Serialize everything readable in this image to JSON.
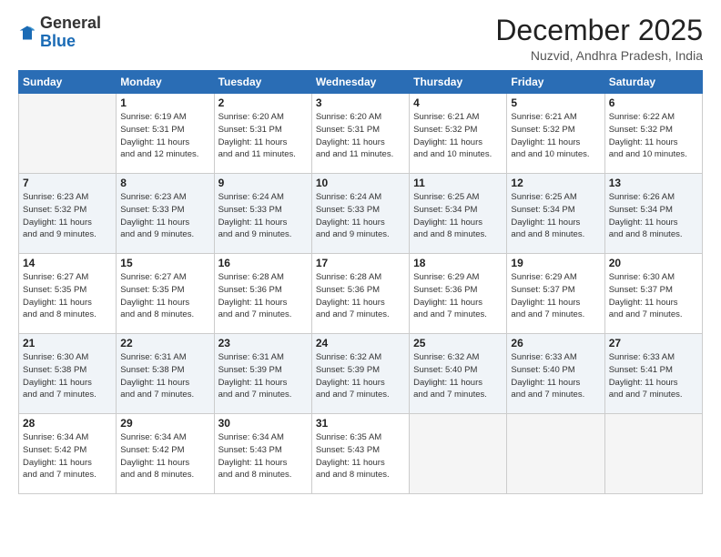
{
  "logo": {
    "general": "General",
    "blue": "Blue"
  },
  "header": {
    "month": "December 2025",
    "location": "Nuzvid, Andhra Pradesh, India"
  },
  "weekdays": [
    "Sunday",
    "Monday",
    "Tuesday",
    "Wednesday",
    "Thursday",
    "Friday",
    "Saturday"
  ],
  "weeks": [
    [
      {
        "num": "",
        "sunrise": "",
        "sunset": "",
        "daylight": "",
        "empty": true
      },
      {
        "num": "1",
        "sunrise": "Sunrise: 6:19 AM",
        "sunset": "Sunset: 5:31 PM",
        "daylight": "Daylight: 11 hours and 12 minutes."
      },
      {
        "num": "2",
        "sunrise": "Sunrise: 6:20 AM",
        "sunset": "Sunset: 5:31 PM",
        "daylight": "Daylight: 11 hours and 11 minutes."
      },
      {
        "num": "3",
        "sunrise": "Sunrise: 6:20 AM",
        "sunset": "Sunset: 5:31 PM",
        "daylight": "Daylight: 11 hours and 11 minutes."
      },
      {
        "num": "4",
        "sunrise": "Sunrise: 6:21 AM",
        "sunset": "Sunset: 5:32 PM",
        "daylight": "Daylight: 11 hours and 10 minutes."
      },
      {
        "num": "5",
        "sunrise": "Sunrise: 6:21 AM",
        "sunset": "Sunset: 5:32 PM",
        "daylight": "Daylight: 11 hours and 10 minutes."
      },
      {
        "num": "6",
        "sunrise": "Sunrise: 6:22 AM",
        "sunset": "Sunset: 5:32 PM",
        "daylight": "Daylight: 11 hours and 10 minutes."
      }
    ],
    [
      {
        "num": "7",
        "sunrise": "Sunrise: 6:23 AM",
        "sunset": "Sunset: 5:32 PM",
        "daylight": "Daylight: 11 hours and 9 minutes."
      },
      {
        "num": "8",
        "sunrise": "Sunrise: 6:23 AM",
        "sunset": "Sunset: 5:33 PM",
        "daylight": "Daylight: 11 hours and 9 minutes."
      },
      {
        "num": "9",
        "sunrise": "Sunrise: 6:24 AM",
        "sunset": "Sunset: 5:33 PM",
        "daylight": "Daylight: 11 hours and 9 minutes."
      },
      {
        "num": "10",
        "sunrise": "Sunrise: 6:24 AM",
        "sunset": "Sunset: 5:33 PM",
        "daylight": "Daylight: 11 hours and 9 minutes."
      },
      {
        "num": "11",
        "sunrise": "Sunrise: 6:25 AM",
        "sunset": "Sunset: 5:34 PM",
        "daylight": "Daylight: 11 hours and 8 minutes."
      },
      {
        "num": "12",
        "sunrise": "Sunrise: 6:25 AM",
        "sunset": "Sunset: 5:34 PM",
        "daylight": "Daylight: 11 hours and 8 minutes."
      },
      {
        "num": "13",
        "sunrise": "Sunrise: 6:26 AM",
        "sunset": "Sunset: 5:34 PM",
        "daylight": "Daylight: 11 hours and 8 minutes."
      }
    ],
    [
      {
        "num": "14",
        "sunrise": "Sunrise: 6:27 AM",
        "sunset": "Sunset: 5:35 PM",
        "daylight": "Daylight: 11 hours and 8 minutes."
      },
      {
        "num": "15",
        "sunrise": "Sunrise: 6:27 AM",
        "sunset": "Sunset: 5:35 PM",
        "daylight": "Daylight: 11 hours and 8 minutes."
      },
      {
        "num": "16",
        "sunrise": "Sunrise: 6:28 AM",
        "sunset": "Sunset: 5:36 PM",
        "daylight": "Daylight: 11 hours and 7 minutes."
      },
      {
        "num": "17",
        "sunrise": "Sunrise: 6:28 AM",
        "sunset": "Sunset: 5:36 PM",
        "daylight": "Daylight: 11 hours and 7 minutes."
      },
      {
        "num": "18",
        "sunrise": "Sunrise: 6:29 AM",
        "sunset": "Sunset: 5:36 PM",
        "daylight": "Daylight: 11 hours and 7 minutes."
      },
      {
        "num": "19",
        "sunrise": "Sunrise: 6:29 AM",
        "sunset": "Sunset: 5:37 PM",
        "daylight": "Daylight: 11 hours and 7 minutes."
      },
      {
        "num": "20",
        "sunrise": "Sunrise: 6:30 AM",
        "sunset": "Sunset: 5:37 PM",
        "daylight": "Daylight: 11 hours and 7 minutes."
      }
    ],
    [
      {
        "num": "21",
        "sunrise": "Sunrise: 6:30 AM",
        "sunset": "Sunset: 5:38 PM",
        "daylight": "Daylight: 11 hours and 7 minutes."
      },
      {
        "num": "22",
        "sunrise": "Sunrise: 6:31 AM",
        "sunset": "Sunset: 5:38 PM",
        "daylight": "Daylight: 11 hours and 7 minutes."
      },
      {
        "num": "23",
        "sunrise": "Sunrise: 6:31 AM",
        "sunset": "Sunset: 5:39 PM",
        "daylight": "Daylight: 11 hours and 7 minutes."
      },
      {
        "num": "24",
        "sunrise": "Sunrise: 6:32 AM",
        "sunset": "Sunset: 5:39 PM",
        "daylight": "Daylight: 11 hours and 7 minutes."
      },
      {
        "num": "25",
        "sunrise": "Sunrise: 6:32 AM",
        "sunset": "Sunset: 5:40 PM",
        "daylight": "Daylight: 11 hours and 7 minutes."
      },
      {
        "num": "26",
        "sunrise": "Sunrise: 6:33 AM",
        "sunset": "Sunset: 5:40 PM",
        "daylight": "Daylight: 11 hours and 7 minutes."
      },
      {
        "num": "27",
        "sunrise": "Sunrise: 6:33 AM",
        "sunset": "Sunset: 5:41 PM",
        "daylight": "Daylight: 11 hours and 7 minutes."
      }
    ],
    [
      {
        "num": "28",
        "sunrise": "Sunrise: 6:34 AM",
        "sunset": "Sunset: 5:42 PM",
        "daylight": "Daylight: 11 hours and 7 minutes."
      },
      {
        "num": "29",
        "sunrise": "Sunrise: 6:34 AM",
        "sunset": "Sunset: 5:42 PM",
        "daylight": "Daylight: 11 hours and 8 minutes."
      },
      {
        "num": "30",
        "sunrise": "Sunrise: 6:34 AM",
        "sunset": "Sunset: 5:43 PM",
        "daylight": "Daylight: 11 hours and 8 minutes."
      },
      {
        "num": "31",
        "sunrise": "Sunrise: 6:35 AM",
        "sunset": "Sunset: 5:43 PM",
        "daylight": "Daylight: 11 hours and 8 minutes."
      },
      {
        "num": "",
        "sunrise": "",
        "sunset": "",
        "daylight": "",
        "empty": true
      },
      {
        "num": "",
        "sunrise": "",
        "sunset": "",
        "daylight": "",
        "empty": true
      },
      {
        "num": "",
        "sunrise": "",
        "sunset": "",
        "daylight": "",
        "empty": true
      }
    ]
  ]
}
